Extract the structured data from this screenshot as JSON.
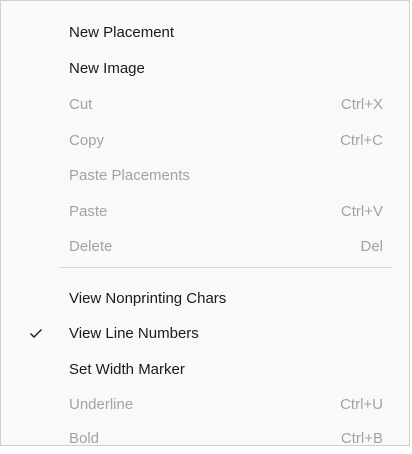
{
  "menu": {
    "items": [
      {
        "label": "New Placement",
        "shortcut": "",
        "enabled": true,
        "checked": false
      },
      {
        "label": "New Image",
        "shortcut": "",
        "enabled": true,
        "checked": false
      },
      {
        "label": "Cut",
        "shortcut": "Ctrl+X",
        "enabled": false,
        "checked": false
      },
      {
        "label": "Copy",
        "shortcut": "Ctrl+C",
        "enabled": false,
        "checked": false
      },
      {
        "label": "Paste Placements",
        "shortcut": "",
        "enabled": false,
        "checked": false
      },
      {
        "label": "Paste",
        "shortcut": "Ctrl+V",
        "enabled": false,
        "checked": false
      },
      {
        "label": "Delete",
        "shortcut": "Del",
        "enabled": false,
        "checked": false
      },
      {
        "label": "View Nonprinting Chars",
        "shortcut": "",
        "enabled": true,
        "checked": false
      },
      {
        "label": "View Line Numbers",
        "shortcut": "",
        "enabled": true,
        "checked": true
      },
      {
        "label": "Set Width Marker",
        "shortcut": "",
        "enabled": true,
        "checked": false
      },
      {
        "label": "Underline",
        "shortcut": "Ctrl+U",
        "enabled": false,
        "checked": false
      },
      {
        "label": "Bold",
        "shortcut": "Ctrl+B",
        "enabled": false,
        "checked": false
      }
    ],
    "checkmark_icon": "checkmark-icon",
    "colors": {
      "enabled_text": "#1a1a1a",
      "disabled_text": "#a3a3a3",
      "background": "#f9f9f9",
      "separator": "#d9d9d9"
    }
  }
}
